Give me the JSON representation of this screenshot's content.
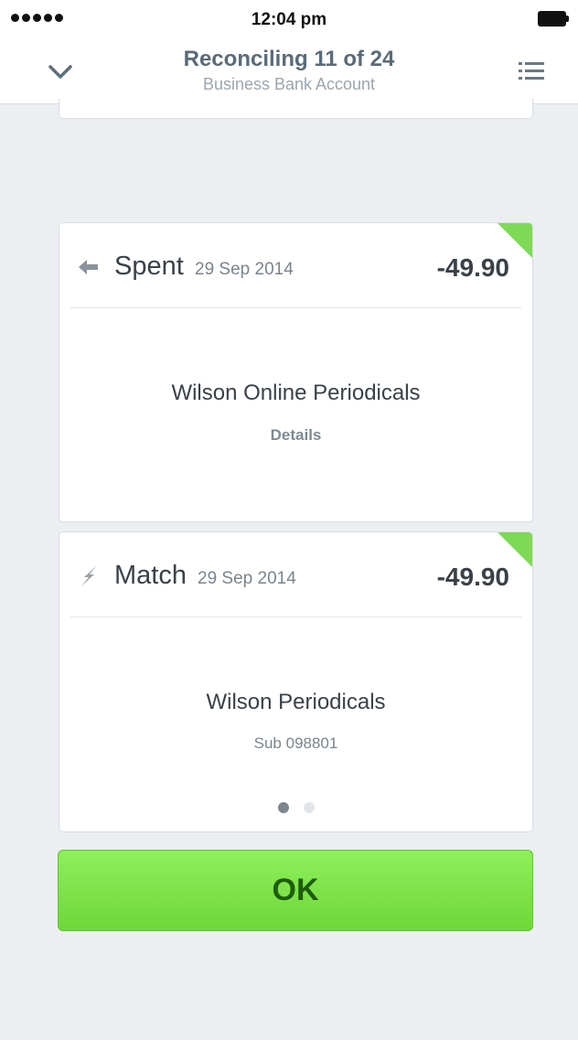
{
  "status_bar": {
    "time": "12:04 pm"
  },
  "header": {
    "title": "Reconciling 11 of 24",
    "subtitle": "Business Bank Account",
    "back_icon": "chevron-down-icon",
    "menu_icon": "list-icon"
  },
  "statement_card": {
    "type": "Spent",
    "date": "29 Sep 2014",
    "amount": "-49.90",
    "payee": "Wilson Online Periodicals",
    "details_label": "Details",
    "icon": "arrow-left-icon",
    "corner_color": "#7ed957"
  },
  "match_card": {
    "type": "Match",
    "date": "29 Sep 2014",
    "amount": "-49.90",
    "payee": "Wilson Periodicals",
    "reference": "Sub 098801",
    "icon": "lightning-icon",
    "corner_color": "#7ed957",
    "page_indicator": {
      "current": 1,
      "total": 2
    }
  },
  "ok_button": {
    "label": "OK",
    "color": "#7ee34a"
  }
}
